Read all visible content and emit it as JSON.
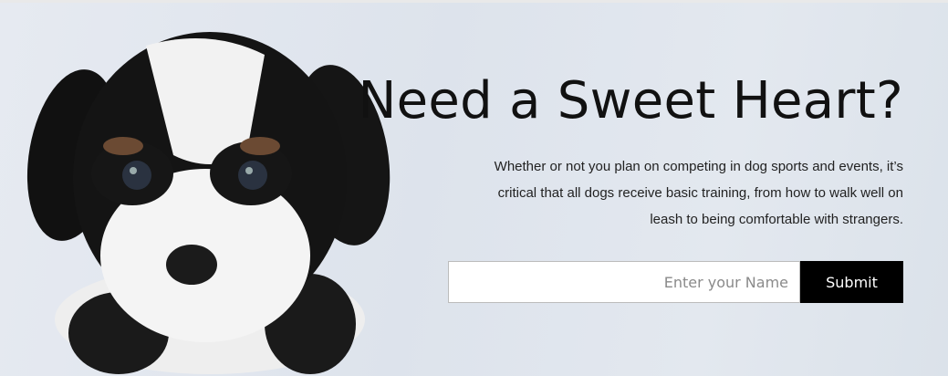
{
  "hero": {
    "title": "Need a Sweet Heart?",
    "description": "Whether or not you plan on competing in dog sports and events, it’s critical that all dogs receive basic training, from how to walk well on leash to being comfortable with strangers."
  },
  "form": {
    "name_placeholder": "Enter your Name",
    "name_value": "",
    "submit_label": "Submit"
  },
  "colors": {
    "button_bg": "#000000",
    "background": "#dfe5ee"
  }
}
